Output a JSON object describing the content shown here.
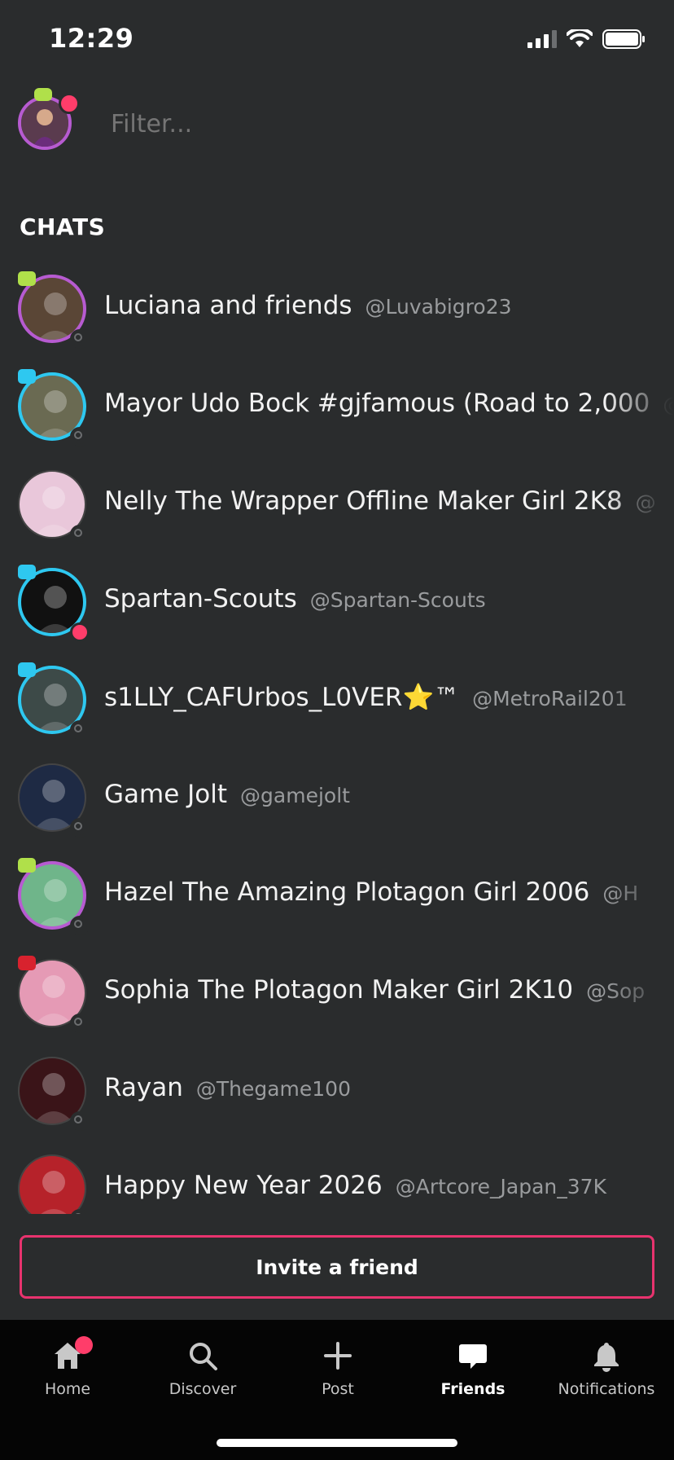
{
  "status_bar": {
    "time": "12:29"
  },
  "filter": {
    "placeholder": "Filter..."
  },
  "section_title": "CHATS",
  "chats": [
    {
      "name": "Luciana and friends",
      "handle": "@Luvabigro23",
      "ring": "purple",
      "presence": "offline",
      "tag": "#b0e04a",
      "avatar_color": "#5a4636"
    },
    {
      "name": "Mayor Udo Bock #gjfamous (Road to 2,000",
      "handle": "@",
      "ring": "blue",
      "presence": "offline",
      "tag": "#2ec8f0",
      "avatar_color": "#6a6a52"
    },
    {
      "name": "Nelly The Wrapper Offline Maker Girl 2K8",
      "handle": "@",
      "ring": "none",
      "presence": "offline",
      "tag": "",
      "avatar_color": "#e9c7da"
    },
    {
      "name": "Spartan-Scouts",
      "handle": "@Spartan-Scouts",
      "ring": "blue",
      "presence": "active",
      "tag": "#2ec8f0",
      "avatar_color": "#111111"
    },
    {
      "name": "s1LLY_CAFUrbos_L0VER⭐™",
      "handle": "@MetroRail201",
      "ring": "blue",
      "presence": "offline",
      "tag": "#2ec8f0",
      "avatar_color": "#3d4a48"
    },
    {
      "name": "Game Jolt",
      "handle": "@gamejolt",
      "ring": "none",
      "presence": "offline",
      "tag": "",
      "avatar_color": "#1e2a44"
    },
    {
      "name": "Hazel The Amazing Plotagon Girl 2006",
      "handle": "@H",
      "ring": "purple",
      "presence": "offline",
      "tag": "#b0e04a",
      "avatar_color": "#6fb58a"
    },
    {
      "name": "Sophia The Plotagon Maker Girl 2K10",
      "handle": "@Sop",
      "ring": "none",
      "presence": "offline",
      "tag": "#d8222e",
      "avatar_color": "#e59ab5"
    },
    {
      "name": "Rayan",
      "handle": "@Thegame100",
      "ring": "none",
      "presence": "offline",
      "tag": "",
      "avatar_color": "#3a1418"
    },
    {
      "name": "Happy New Year 2026",
      "handle": "@Artcore_Japan_37K",
      "ring": "none",
      "presence": "offline",
      "tag": "",
      "avatar_color": "#b6222a"
    }
  ],
  "invite_label": "Invite a friend",
  "nav": [
    {
      "label": "Home",
      "icon": "home-icon",
      "active": false,
      "dot": true
    },
    {
      "label": "Discover",
      "icon": "search-icon",
      "active": false,
      "dot": false
    },
    {
      "label": "Post",
      "icon": "plus-icon",
      "active": false,
      "dot": false
    },
    {
      "label": "Friends",
      "icon": "chat-bubble-icon",
      "active": true,
      "dot": false
    },
    {
      "label": "Notifications",
      "icon": "bell-icon",
      "active": false,
      "dot": false
    }
  ],
  "colors": {
    "background": "#2a2c2d",
    "accent": "#e8336e",
    "ring_blue": "#2ec8f0",
    "ring_purple": "#b75bd1",
    "nav_bg": "#050505"
  }
}
